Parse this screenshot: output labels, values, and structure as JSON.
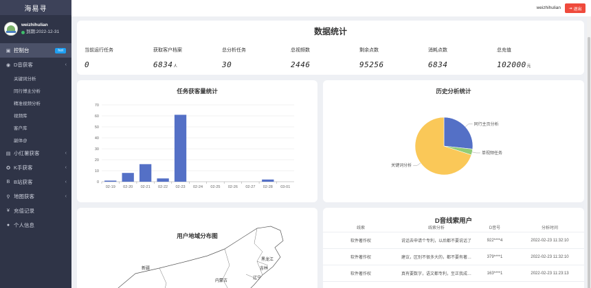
{
  "sidebar": {
    "brand": "海易寻",
    "user_name": "weizhihulian",
    "expiry": "到期:2022-12-31",
    "items": [
      {
        "label": "控制台",
        "icon": "dashboard-icon",
        "glyph": "▣",
        "active": true,
        "badge": "hot"
      },
      {
        "label": "D音获客",
        "icon": "eye-icon",
        "glyph": "◉",
        "expanded": true
      },
      {
        "label": "小红薯获客",
        "icon": "image-icon",
        "glyph": "▤"
      },
      {
        "label": "K手获客",
        "icon": "target-icon",
        "glyph": "✪"
      },
      {
        "label": "B站获客",
        "icon": "b-logo-icon",
        "glyph": "B"
      },
      {
        "label": "地图获客",
        "icon": "map-pin-icon",
        "glyph": "⚲"
      },
      {
        "label": "充值记录",
        "icon": "yen-icon",
        "glyph": "¥"
      },
      {
        "label": "个人信息",
        "icon": "user-icon",
        "glyph": "●"
      }
    ],
    "subitems": [
      "关键词分析",
      "同行博主分析",
      "精准视频分析",
      "视频库",
      "客户库",
      "副体@"
    ]
  },
  "topbar": {
    "user": "weizhihulian",
    "logout_label": "退出",
    "logout_icon": "logout-icon"
  },
  "stats": {
    "title": "数据统计",
    "items": [
      {
        "label": "当前运行任务",
        "value": "0",
        "unit": ""
      },
      {
        "label": "获取客户档案",
        "value": "6834",
        "unit": "人"
      },
      {
        "label": "总分析任务",
        "value": "30",
        "unit": ""
      },
      {
        "label": "总视频数",
        "value": "2446",
        "unit": ""
      },
      {
        "label": "剩余点数",
        "value": "95256",
        "unit": ""
      },
      {
        "label": "消耗点数",
        "value": "6834",
        "unit": ""
      },
      {
        "label": "总充值",
        "value": "102000",
        "unit": "元"
      }
    ]
  },
  "bar_panel": {
    "title": "任务获客量统计"
  },
  "pie_panel": {
    "title": "历史分析统计"
  },
  "map_panel": {
    "title": "用户地域分布图",
    "labels": [
      "新疆",
      "黑龙江",
      "吉林",
      "辽宁",
      "内蒙古"
    ]
  },
  "table_panel": {
    "title": "D音线索用户",
    "headers": [
      "线索",
      "线索分析",
      "D音号",
      "分析时间"
    ],
    "rows": [
      [
        "软件著作权",
        "说话去申请个专利，以后都不要说话了",
        "922****4",
        "2022-02-23 11:32:10"
      ],
      [
        "软件著作权",
        "建议，区别不很多大的，都不要有著…",
        "379****1",
        "2022-02-23 11:32:10"
      ],
      [
        "软件著作权",
        "真有要数字，语文都专利，至正我成…",
        "163****1",
        "2022-02-23 11:23:13"
      ]
    ]
  },
  "chart_data": [
    {
      "type": "bar",
      "title": "任务获客量统计",
      "categories": [
        "02-19",
        "02-20",
        "02-21",
        "02-22",
        "02-23",
        "02-24",
        "02-25",
        "02-26",
        "02-27",
        "02-28",
        "03-01"
      ],
      "values": [
        1,
        8,
        16,
        3,
        61,
        0,
        0,
        0,
        0,
        2,
        0
      ],
      "ylim": [
        0,
        70
      ],
      "yticks": [
        0,
        10,
        20,
        30,
        40,
        50,
        60,
        70
      ],
      "grid": true,
      "color": "#5470c6"
    },
    {
      "type": "pie",
      "title": "历史分析统计",
      "categories": [
        "同行主页分析",
        "单视频任务",
        "关键词分析"
      ],
      "values": [
        8,
        1,
        21
      ],
      "colors": [
        "#5470c6",
        "#91cc75",
        "#fac858"
      ]
    }
  ]
}
